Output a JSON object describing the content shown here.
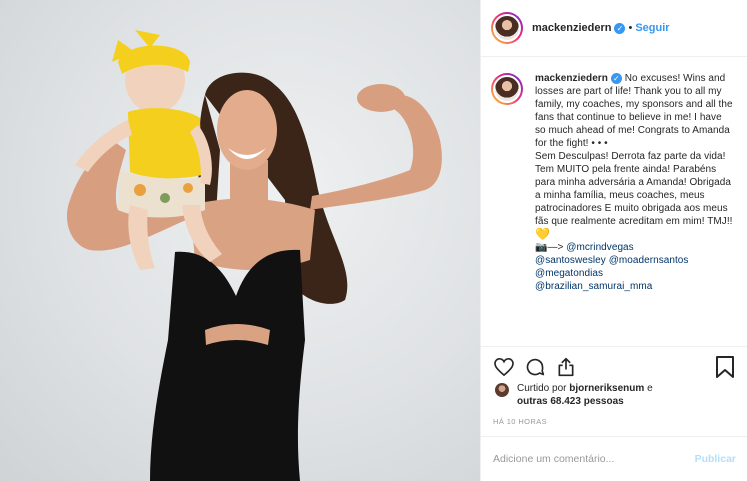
{
  "post": {
    "username": "mackenziedern",
    "verified_icon": "verified-badge-icon",
    "separator": "•",
    "follow_label": "Seguir"
  },
  "caption": {
    "username": "mackenziedern",
    "lines": [
      "No excuses! Wins and losses are part of life! Thank you to all my family, my coaches, my sponsors and all the fans that continue to believe in me! I have so much ahead of me! Congrats to Amanda for the fight! • • •",
      "Sem Desculpas! Derrota faz parte da vida! Tem MUITO pela frente ainda! Parabéns para minha adversária a Amanda! Obrigada a minha família, meus coaches, meus patrocinadores E muito obrigada aos meus fãs que realmente acreditam em mim! TMJ!!"
    ],
    "heart_emoji": "💛",
    "camera_arrow": "📷—> ",
    "mentions": [
      "@mcrindvegas",
      "@santoswesley",
      "@moadernsantos",
      "@megatondias",
      "@brazilian_samurai_mma"
    ]
  },
  "actions": {
    "like_icon": "heart-icon",
    "comment_icon": "comment-icon",
    "share_icon": "share-icon",
    "save_icon": "bookmark-icon"
  },
  "likes": {
    "prefix": "Curtido por",
    "user": "bjorneriksenum",
    "middle": "e",
    "others": "outras 68.423 pessoas"
  },
  "time_ago": "HÁ 10 HORAS",
  "comment": {
    "placeholder": "Adicione um comentário...",
    "publish_label": "Publicar"
  },
  "colors": {
    "accent": "#3897f0",
    "publish_disabled": "#b2dffc",
    "mention": "#003569",
    "dress": "#111111",
    "headband": "#f5cf1e"
  }
}
